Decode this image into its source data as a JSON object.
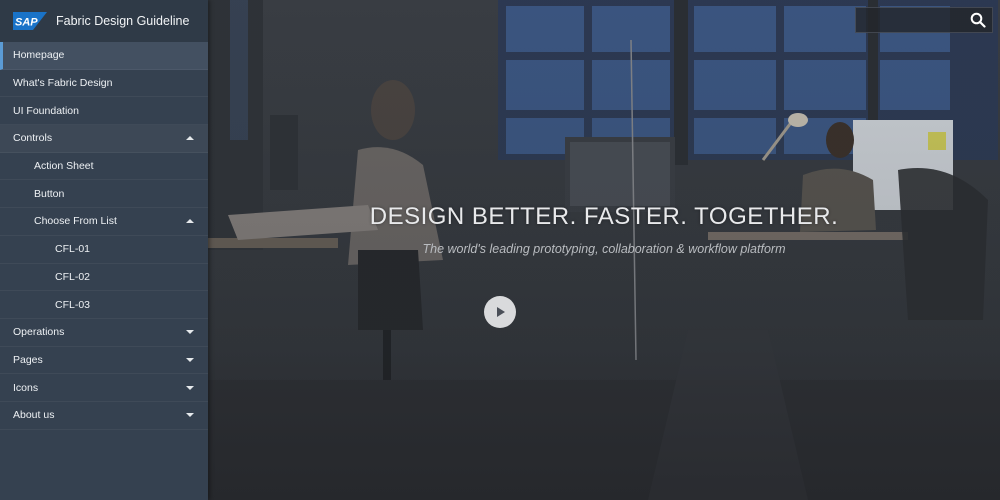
{
  "app": {
    "brand_logo_text": "SAP",
    "title": "Fabric Design Guideline"
  },
  "sidebar": {
    "items": [
      {
        "label": "Homepage",
        "level": 0,
        "state": "active"
      },
      {
        "label": "What's Fabric Design",
        "level": 0
      },
      {
        "label": "UI Foundation",
        "level": 0
      },
      {
        "label": "Controls",
        "level": 0,
        "expanded": true
      },
      {
        "label": "Action Sheet",
        "level": 1
      },
      {
        "label": "Button",
        "level": 1
      },
      {
        "label": "Choose From List",
        "level": 1,
        "expanded": true
      },
      {
        "label": "CFL-01",
        "level": 2
      },
      {
        "label": "CFL-02",
        "level": 2
      },
      {
        "label": "CFL-03",
        "level": 2
      },
      {
        "label": "Operations",
        "level": 0,
        "expanded": false
      },
      {
        "label": "Pages",
        "level": 0,
        "expanded": false
      },
      {
        "label": "Icons",
        "level": 0,
        "expanded": false
      },
      {
        "label": "About us",
        "level": 0,
        "expanded": false
      }
    ]
  },
  "hero": {
    "headline": "DESIGN BETTER. FASTER. TOGETHER.",
    "tagline": "The world's leading prototyping, collaboration & workflow platform",
    "play_icon": "play-icon"
  },
  "search": {
    "value": "",
    "placeholder": "",
    "icon": "search-icon"
  },
  "colors": {
    "sidebar_bg": "#354150",
    "brand_blue": "#1a73c8",
    "active_accent": "#5b9bd5"
  }
}
